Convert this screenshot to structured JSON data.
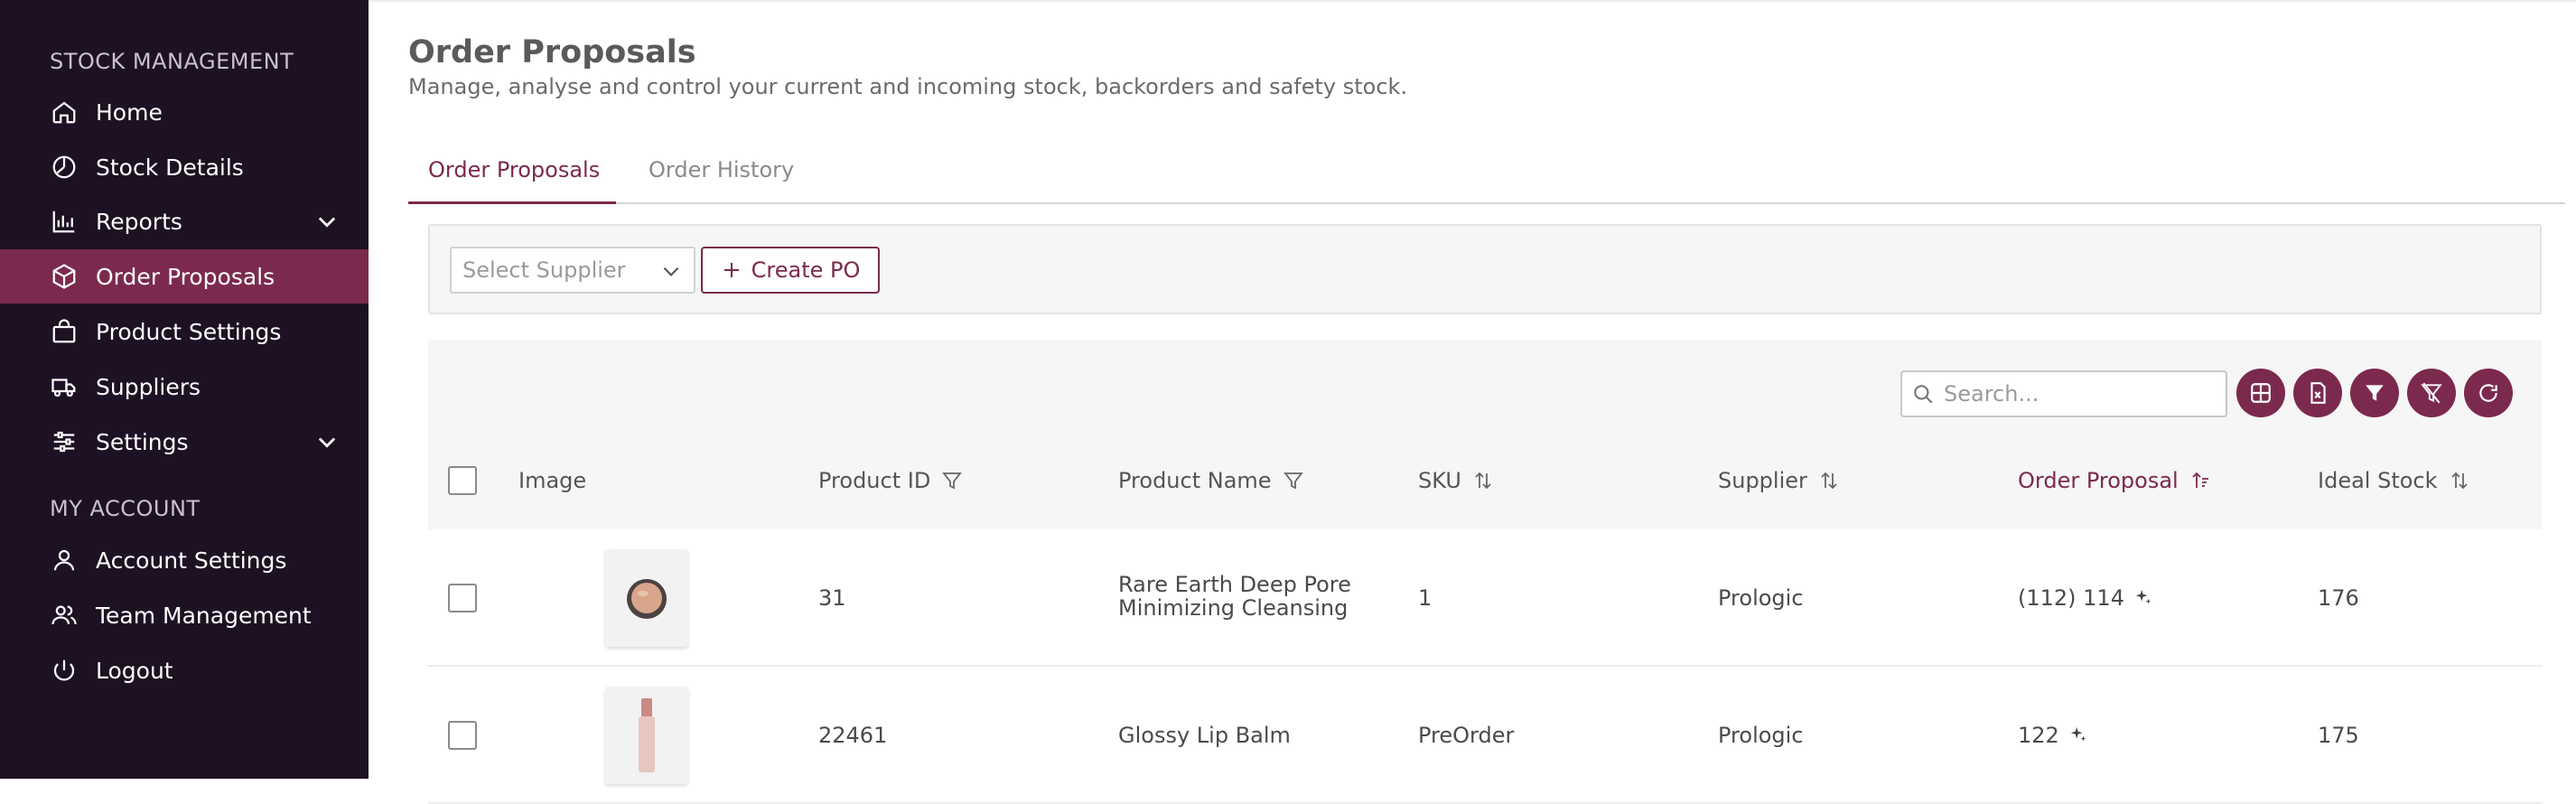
{
  "sidebar": {
    "section_stock": "STOCK MANAGEMENT",
    "section_account": "MY ACCOUNT",
    "items": [
      {
        "label": "Home",
        "icon": "home-icon"
      },
      {
        "label": "Stock Details",
        "icon": "clock-chart-icon"
      },
      {
        "label": "Reports",
        "icon": "bar-chart-icon"
      },
      {
        "label": "Order Proposals",
        "icon": "box-icon",
        "active": true
      },
      {
        "label": "Product Settings",
        "icon": "shopping-bag-icon"
      },
      {
        "label": "Suppliers",
        "icon": "truck-icon"
      },
      {
        "label": "Settings",
        "icon": "sliders-icon"
      },
      {
        "label": "Account Settings",
        "icon": "user-icon"
      },
      {
        "label": "Team Management",
        "icon": "users-icon"
      },
      {
        "label": "Logout",
        "icon": "power-icon"
      }
    ]
  },
  "header": {
    "title": "Order Proposals",
    "subtitle": "Manage, analyse and control your current and incoming stock, backorders and safety stock."
  },
  "tabs": [
    {
      "label": "Order Proposals",
      "active": true
    },
    {
      "label": "Order History",
      "active": false
    }
  ],
  "toolbar": {
    "supplier_placeholder": "Select Supplier",
    "create_po_label": "Create PO"
  },
  "table": {
    "search_placeholder": "Search...",
    "action_icons": [
      "grid-icon",
      "excel-export-icon",
      "filter-icon",
      "clear-filter-icon",
      "refresh-icon"
    ],
    "columns": [
      "Image",
      "Product ID",
      "Product Name",
      "SKU",
      "Supplier",
      "Order Proposal",
      "Ideal Stock"
    ],
    "rows": [
      {
        "product_id": "31",
        "product_name_line1": "Rare Earth Deep Pore",
        "product_name_line2": "Minimizing Cleansing",
        "sku": "1",
        "supplier": "Prologic",
        "order_proposal": "(112) 114",
        "ideal_stock": "176"
      },
      {
        "product_id": "22461",
        "product_name_line1": "Glossy Lip Balm",
        "product_name_line2": "",
        "sku": "PreOrder",
        "supplier": "Prologic",
        "order_proposal": "122",
        "ideal_stock": "175"
      }
    ]
  },
  "colors": {
    "sidebar_bg": "#1e1124",
    "accent": "#7b2a4e"
  }
}
